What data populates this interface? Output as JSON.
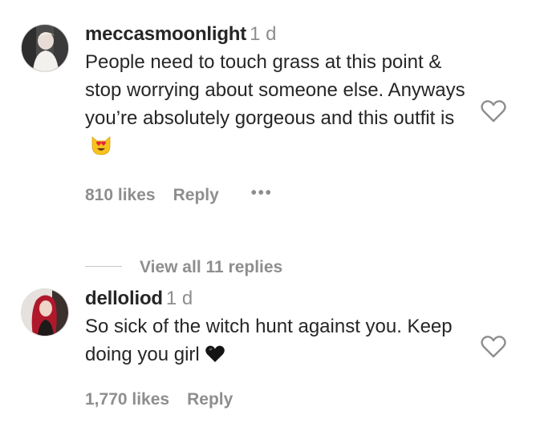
{
  "comments": [
    {
      "username": "meccasmoonlight",
      "time": "1 d",
      "text": "People need to touch grass at this point & stop worrying about someone else. Anyways you’re absolutely gorgeous and this outfit is",
      "emoji": "heart-eyes-cat",
      "likes": "810 likes",
      "reply": "Reply",
      "more": "•••",
      "view_replies": "View all 11 replies"
    },
    {
      "username": "delloliod",
      "time": "1 d",
      "text": "So sick of the witch hunt against you. Keep doing you girl",
      "emoji": "black-heart",
      "likes": "1,770 likes",
      "reply": "Reply"
    }
  ],
  "colors": {
    "text": "#262626",
    "muted": "#8e8e8e"
  }
}
